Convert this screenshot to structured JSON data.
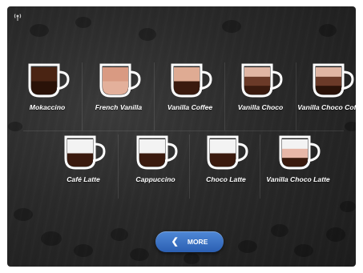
{
  "drinks_row1": [
    {
      "label": "Mokaccino",
      "layers": [
        "#2a1208",
        "#4a2413"
      ]
    },
    {
      "label": "French Vanilla",
      "layers": [
        "#e3b09b",
        "#d99a82"
      ]
    },
    {
      "label": "Vanilla Coffee",
      "layers": [
        "#3a1a0e",
        "#dfab93"
      ]
    },
    {
      "label": "Vanilla Choco",
      "layers": [
        "#3a1a0e",
        "#6b3a28",
        "#e0b6a4"
      ]
    },
    {
      "label": "Vanilla Choco Coffee",
      "layers": [
        "#2a1208",
        "#6b3a28",
        "#e0b6a4"
      ]
    }
  ],
  "drinks_row2": [
    {
      "label": "Café Latte",
      "layers": [
        "#3a1a0e",
        "#f3f3f3"
      ]
    },
    {
      "label": "Cappuccino",
      "layers": [
        "#3a1a0e",
        "#f3f3f3"
      ]
    },
    {
      "label": "Choco Latte",
      "layers": [
        "#3a1a0e",
        "#f3f3f3"
      ]
    },
    {
      "label": "Vanilla Choco Latte",
      "layers": [
        "#3a1a0e",
        "#e7b7a8",
        "#f3f3f3"
      ]
    }
  ],
  "more_button": {
    "label": "MORE",
    "icon": "chevron-left-icon"
  },
  "status": {
    "icon": "wifi-antenna-icon"
  },
  "colors": {
    "button": "#3566bd",
    "text": "#ffffff"
  }
}
